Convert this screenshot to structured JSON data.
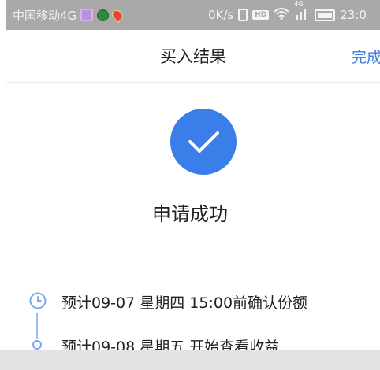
{
  "status_bar": {
    "carrier": "中国移动4G",
    "speed": "0K/s",
    "hd": "HD",
    "network": "4G",
    "time": "23:0"
  },
  "nav": {
    "title": "买入结果",
    "done_label": "完成"
  },
  "result": {
    "message": "申请成功"
  },
  "timeline": [
    {
      "text": "预计09-07 星期四 15:00前确认份额"
    },
    {
      "text": "预计09-08 星期五 开始查看收益"
    }
  ],
  "colors": {
    "accent": "#3b7de9",
    "status_bar": "#a9a9a9"
  }
}
